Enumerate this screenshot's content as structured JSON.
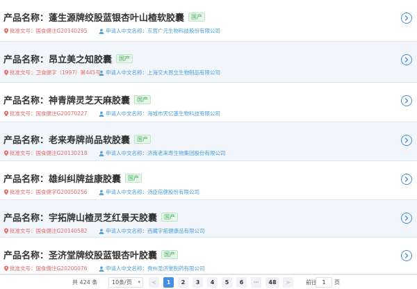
{
  "list": {
    "prefix": "产品名称：",
    "approval_prefix": "批准文号：",
    "applicant_prefix": "申请人中文名称：",
    "items": [
      {
        "name": "蓬生源牌绞股蓝银杏叶山楂软胶囊",
        "tag": "国产",
        "approval": "国食健注G20140295",
        "applicant": "东营广元生物科技股份有限公司"
      },
      {
        "name": "昂立美之知胶囊",
        "tag": "国产",
        "approval": "卫食健字（1997）第445号",
        "applicant": "上海交大昂立生物制品有限公司"
      },
      {
        "name": "神青牌灵芝天麻胶囊",
        "tag": "国产",
        "approval": "国食健注G20070227",
        "applicant": "海城市天亿蓬生物科技有限公司"
      },
      {
        "name": "老来寿牌尚品软胶囊",
        "tag": "国产",
        "approval": "国食健注G20130218",
        "applicant": "济南老来寿生物集团股份有限公司"
      },
      {
        "name": "雄纠纠牌益康胶囊",
        "tag": "国产",
        "approval": "国食健字G20050256",
        "applicant": "汤臣倍健股份有限公司"
      },
      {
        "name": "宇拓牌山楂灵芝红景天胶囊",
        "tag": "国产",
        "approval": "国食健注G20140582",
        "applicant": "西藏宇拓健康品有限公司"
      },
      {
        "name": "圣济堂牌绞股蓝银杏叶胶囊",
        "tag": "国产",
        "approval": "国食健注G20200076",
        "applicant": "贵州圣济堂制药有限公司"
      }
    ]
  },
  "pagination": {
    "total_text": "共 424 条",
    "page_size": "10条/页",
    "pages": [
      "1",
      "2",
      "3",
      "4",
      "5",
      "6",
      "···",
      "48"
    ],
    "current_page": "1",
    "goto_label": "前往",
    "goto_value": "1",
    "page_label": "页",
    "prev": "<",
    "next": ">"
  },
  "colors": {
    "accent": "#4090e8",
    "approval_red": "#e46a6a",
    "applicant_blue": "#4a9fd8",
    "tag_green": "#46b05d",
    "row_alt": "#f2f6fb"
  },
  "icons": {
    "approval": "location-pin-icon",
    "applicant": "person-icon",
    "row_action": "chevron-right-circle-icon"
  }
}
